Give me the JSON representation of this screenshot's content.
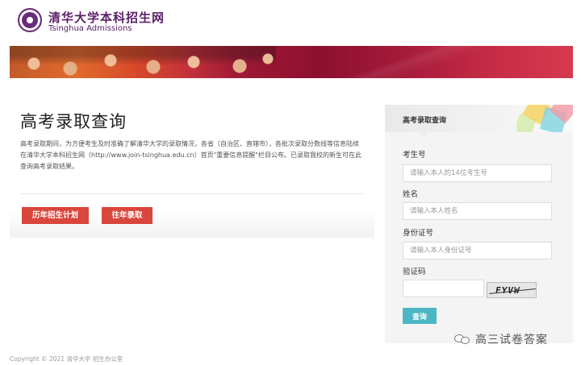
{
  "header": {
    "site_name_cn": "清华大学本科招生网",
    "site_name_en": "Tsinghua Admissions"
  },
  "main": {
    "title": "高考录取查询",
    "description": "高考录取期间，为方便考生及时准确了解清华大学的录取情况，各省（自治区、直辖市），各批次录取分数线等信息陆续在清华大学本科招生网（http://www.join-tsinghua.edu.cn）首页\"重要信息提醒\"栏目公布。已录取我校的新生可在此查询高考录取结果。",
    "buttons": {
      "plan_label": "历年招生计划",
      "past_label": "往年录取"
    }
  },
  "panel": {
    "title": "高考录取查询",
    "fields": {
      "exam_no_label": "考生号",
      "exam_no_placeholder": "请输入本人的14位考生号",
      "name_label": "姓名",
      "name_placeholder": "请输入本人姓名",
      "id_label": "身份证号",
      "id_placeholder": "请输入本人身份证号",
      "captcha_label": "验证码",
      "captcha_text": "FYVW"
    },
    "submit_label": "查询"
  },
  "watermark": {
    "text": "高三试卷答案"
  },
  "footer": {
    "copyright": "Copyright © 2021 清华大学 招生办公室"
  },
  "colors": {
    "brand_purple": "#5b2168",
    "button_red": "#d9463b",
    "submit_teal": "#4cb6c5"
  }
}
